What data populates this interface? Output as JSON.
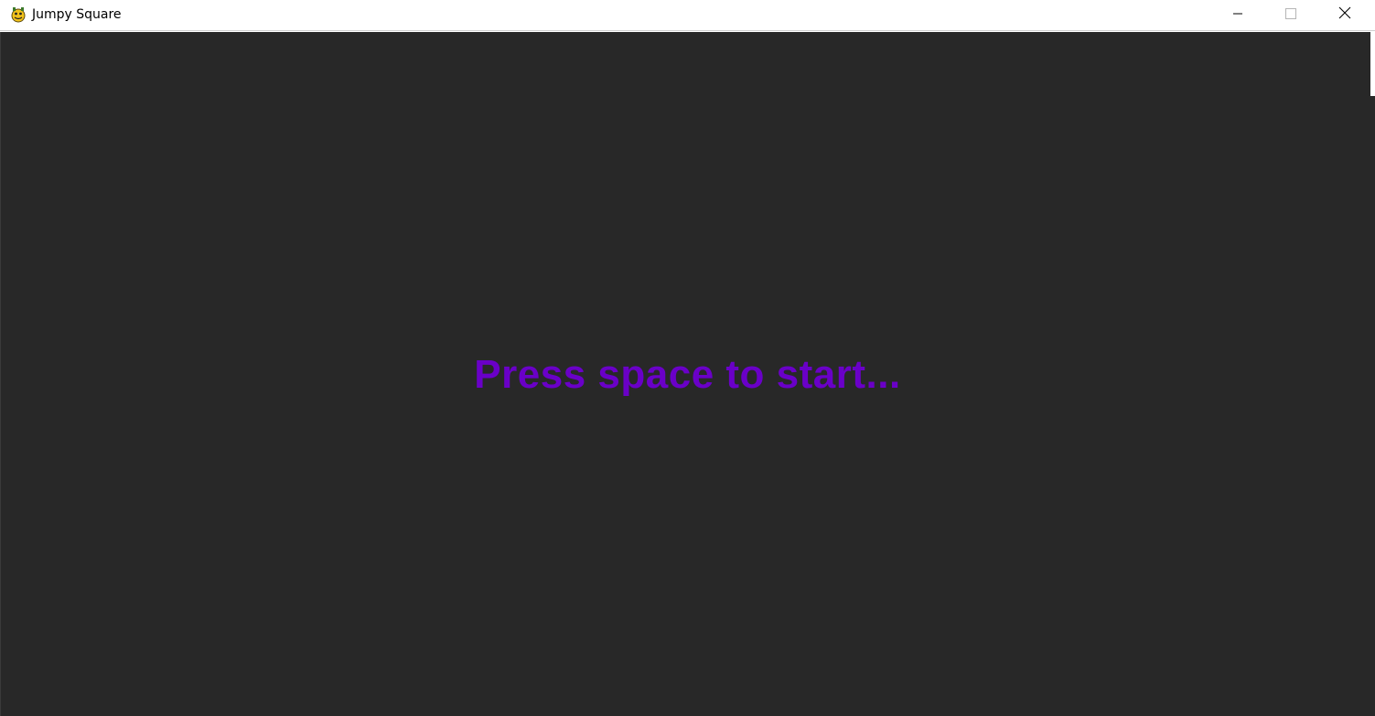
{
  "window": {
    "title": "Jumpy Square",
    "icon": "pygame-snake-icon",
    "buttons": {
      "minimize": "minimize-icon",
      "maximize": "maximize-icon",
      "close": "close-icon"
    }
  },
  "game": {
    "background_color": "#282828",
    "prompt_text": "Press space to start...",
    "prompt_color": "#6a00c8"
  }
}
